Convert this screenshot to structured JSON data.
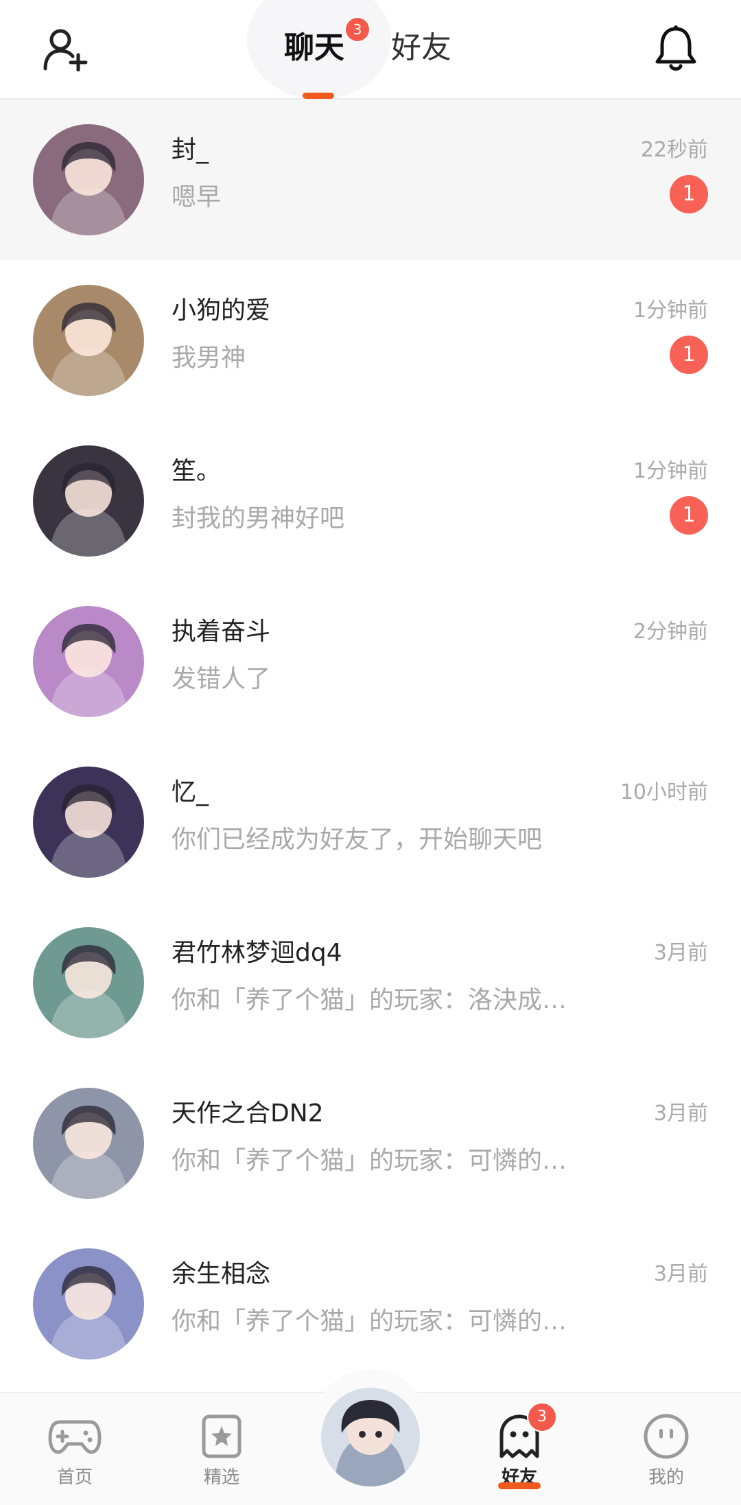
{
  "header": {
    "tabs": [
      {
        "label": "聊天",
        "badge": "3",
        "active": true
      },
      {
        "label": "好友",
        "active": false
      }
    ],
    "add_friend_icon": "add-user-icon",
    "notification_icon": "bell-icon"
  },
  "conversations": [
    {
      "name": "封_",
      "preview": "嗯早",
      "time": "22秒前",
      "unread": "1",
      "avatar_color": "#8a6b7d"
    },
    {
      "name": "小狗的爱",
      "preview": "我男神",
      "time": "1分钟前",
      "unread": "1",
      "avatar_color": "#a88a6a"
    },
    {
      "name": "笙。",
      "preview": "封我的男神好吧",
      "time": "1分钟前",
      "unread": "1",
      "avatar_color": "#3a3440"
    },
    {
      "name": "执着奋斗",
      "preview": "发错人了",
      "time": "2分钟前",
      "unread": "",
      "avatar_color": "#b98ac7"
    },
    {
      "name": "忆_",
      "preview": "你们已经成为好友了，开始聊天吧",
      "time": "10小时前",
      "unread": "",
      "avatar_color": "#3d3358"
    },
    {
      "name": "君竹林梦迴dq4",
      "preview": "你和「养了个猫」的玩家：洛決成…",
      "time": "3月前",
      "unread": "",
      "avatar_color": "#6f9a92"
    },
    {
      "name": "天作之合DN2",
      "preview": "你和「养了个猫」的玩家：可憐的…",
      "time": "3月前",
      "unread": "",
      "avatar_color": "#8f95a8"
    },
    {
      "name": "余生相念",
      "preview": "你和「养了个猫」的玩家：可憐的…",
      "time": "3月前",
      "unread": "",
      "avatar_color": "#8a92c7"
    }
  ],
  "bottom_nav": {
    "items": [
      {
        "label": "首页",
        "icon": "gamepad-icon"
      },
      {
        "label": "精选",
        "icon": "star-bookmark-icon"
      },
      {
        "label": "好友",
        "icon": "ghost-icon",
        "badge": "3",
        "active": true
      },
      {
        "label": "我的",
        "icon": "smiley-face-icon"
      }
    ],
    "center_avatar_color": "#c8d0dc"
  },
  "colors": {
    "accent": "#f05a1c",
    "badge": "#f45a4c",
    "unread": "#f76156"
  }
}
